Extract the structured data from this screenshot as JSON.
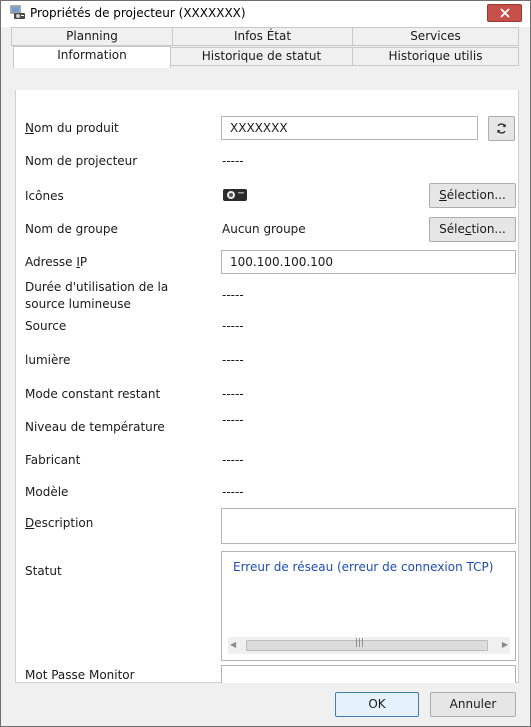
{
  "window": {
    "title": "Propriétés de projecteur (XXXXXXX)"
  },
  "tabs": {
    "row1": [
      "Planning",
      "Infos État",
      "Services"
    ],
    "row2": [
      "Information",
      "Historique de statut",
      "Historique utilis"
    ],
    "active": "Information"
  },
  "fields": {
    "product_name": {
      "label_u": "N",
      "label_rest": "om du produit",
      "value": "XXXXXXX"
    },
    "projector_name": {
      "label": "Nom de projecteur",
      "value": "-----"
    },
    "icons": {
      "label": "Icônes",
      "button_u": "S",
      "button_rest": "élection..."
    },
    "group_name": {
      "label": "Nom de groupe",
      "value": "Aucun groupe",
      "button_pre": "Séle",
      "button_u": "c",
      "button_rest": "tion..."
    },
    "ip_address": {
      "label_pre": "Adresse ",
      "label_u": "I",
      "label_rest": "P",
      "value": "100.100.100.100"
    },
    "light_source_usage": {
      "label_line1": "Durée d'utilisation de la",
      "label_line2": "source lumineuse",
      "value": "-----"
    },
    "source": {
      "label": "Source",
      "value": "-----"
    },
    "light": {
      "label": "lumière",
      "value": "-----"
    },
    "constant_mode": {
      "label": "Mode constant restant",
      "value": "-----"
    },
    "temperature": {
      "label": "Niveau de température",
      "value": "-----"
    },
    "manufacturer": {
      "label": "Fabricant",
      "value": "-----"
    },
    "model": {
      "label": "Modèle",
      "value": "-----"
    },
    "description": {
      "label_u": "D",
      "label_rest": "escription",
      "value": ""
    },
    "status": {
      "label": "Statut",
      "value": "Erreur de réseau (erreur de connexion TCP)"
    },
    "monitor_password": {
      "label": "Mot Passe Monitor",
      "value": ""
    }
  },
  "footer": {
    "ok_label": "OK",
    "cancel_label": "Annuler"
  },
  "colors": {
    "status_text": "#1f4fb0",
    "close_button": "#c7504b",
    "ok_border": "#3c7fb1"
  },
  "icons": [
    "projector-properties-icon",
    "close-icon",
    "refresh-icon",
    "projector-icon",
    "scroll-left-icon",
    "scroll-right-icon"
  ]
}
